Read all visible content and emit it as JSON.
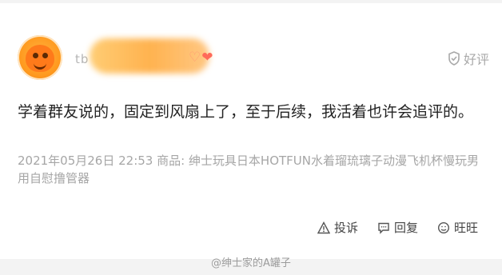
{
  "post": {
    "username": "tb",
    "good_review": "好评",
    "content": "学着群友说的，固定到风扇上了，至于后续，我活着也许会追评的。",
    "meta": "2021年05月26日 22:53 商品: 绅士玩具日本HOTFUN水着瑠琉璃子动漫飞机杯慢玩男用自慰撸管器"
  },
  "actions": {
    "report": "投诉",
    "reply": "回复",
    "wangwang": "旺旺"
  },
  "watermark": "@绅士家的A罐子",
  "icons": {
    "avatar": "orange-mascot-avatar",
    "badge": "heart-badge-icon",
    "good_review": "shield-icon",
    "report": "warning-icon",
    "reply": "comment-icon",
    "wangwang": "chat-icon"
  },
  "colors": {
    "background": "#ffffff",
    "page": "#f3f3f3",
    "text": "#222222",
    "muted": "#a6a6a6",
    "accent": "#ff9a1f"
  }
}
